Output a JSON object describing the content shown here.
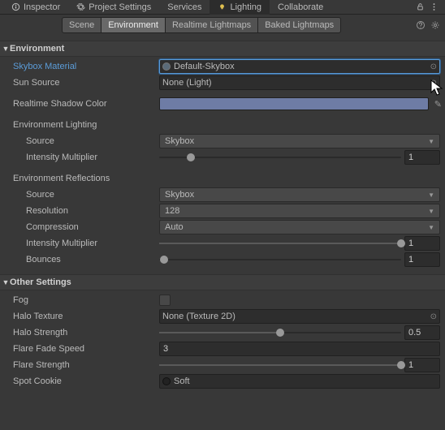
{
  "topTabs": {
    "inspector": "Inspector",
    "projectSettings": "Project Settings",
    "services": "Services",
    "lighting": "Lighting",
    "collaborate": "Collaborate"
  },
  "subTabs": {
    "scene": "Scene",
    "environment": "Environment",
    "realtime": "Realtime Lightmaps",
    "baked": "Baked Lightmaps"
  },
  "sections": {
    "environment": "Environment",
    "otherSettings": "Other Settings"
  },
  "env": {
    "skyboxMaterial_label": "Skybox Material",
    "skyboxMaterial_value": "Default-Skybox",
    "sunSource_label": "Sun Source",
    "sunSource_value": "None (Light)",
    "realtimeShadowColor_label": "Realtime Shadow Color",
    "envLighting_header": "Environment Lighting",
    "source_label": "Source",
    "source_value": "Skybox",
    "intensityMult_label": "Intensity Multiplier",
    "intensityMult_value": "1",
    "envReflections_header": "Environment Reflections",
    "refl_source_label": "Source",
    "refl_source_value": "Skybox",
    "resolution_label": "Resolution",
    "resolution_value": "128",
    "compression_label": "Compression",
    "compression_value": "Auto",
    "refl_intensityMult_label": "Intensity Multiplier",
    "refl_intensityMult_value": "1",
    "bounces_label": "Bounces",
    "bounces_value": "1"
  },
  "other": {
    "fog_label": "Fog",
    "haloTexture_label": "Halo Texture",
    "haloTexture_value": "None (Texture 2D)",
    "haloStrength_label": "Halo Strength",
    "haloStrength_value": "0.5",
    "flareFadeSpeed_label": "Flare Fade Speed",
    "flareFadeSpeed_value": "3",
    "flareStrength_label": "Flare Strength",
    "flareStrength_value": "1",
    "spotCookie_label": "Spot Cookie",
    "spotCookie_value": "Soft"
  },
  "colors": {
    "realtimeShadow": "#6e7ca5"
  }
}
